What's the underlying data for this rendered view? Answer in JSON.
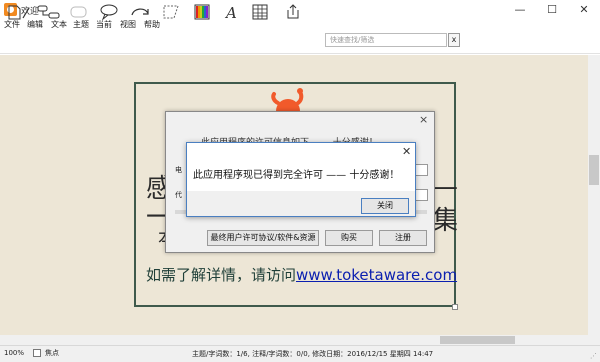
{
  "window": {
    "title": "欢迎",
    "minimize": "—",
    "maximize": "☐",
    "close": "✕"
  },
  "menu": [
    "文件",
    "编辑",
    "文本",
    "主题",
    "当前",
    "视图",
    "帮助"
  ],
  "toolbar": {
    "icons": [
      "new-note-icon",
      "pen-icon",
      "mind-map-icon",
      "cloud-icon",
      "speech-bubble-icon",
      "undo-redo-icon",
      "lasso-icon",
      "color-swatch-icon",
      "font-icon",
      "table-icon",
      "share-icon"
    ],
    "search_placeholder": "快速查找/筛选",
    "search_clear": "x"
  },
  "document": {
    "line1": "感",
    "line2": "一",
    "line3": "本",
    "right1": "—",
    "right2": "集",
    "visit_prefix": "如需了解详情，请访问",
    "visit_link": "www.toketaware.com"
  },
  "dialog_license": {
    "faded_text": "此应用程序的许可信息如下 —— 十分感谢！",
    "field1_label": "电",
    "field2_label": "代",
    "close": "×",
    "buttons": {
      "eula": "最终用户许可协议/软件&资源",
      "buy": "购买",
      "register": "注册"
    }
  },
  "dialog_confirm": {
    "message": "此应用程序现已得到完全许可 —— 十分感谢！",
    "close": "✕",
    "ok": "关闭"
  },
  "status": {
    "zoom": "100%",
    "focus": "焦点",
    "info": "主题/字词数：1/6, 注释/字词数：0/0, 修改日期：2016/12/15 星期四 14:47"
  },
  "colors": {
    "workspace": "#ede6d6",
    "card_border": "#3f5a4c",
    "link": "#0b1fb0",
    "logo": "#f15a2b",
    "accent_border": "#4a7fc1"
  }
}
